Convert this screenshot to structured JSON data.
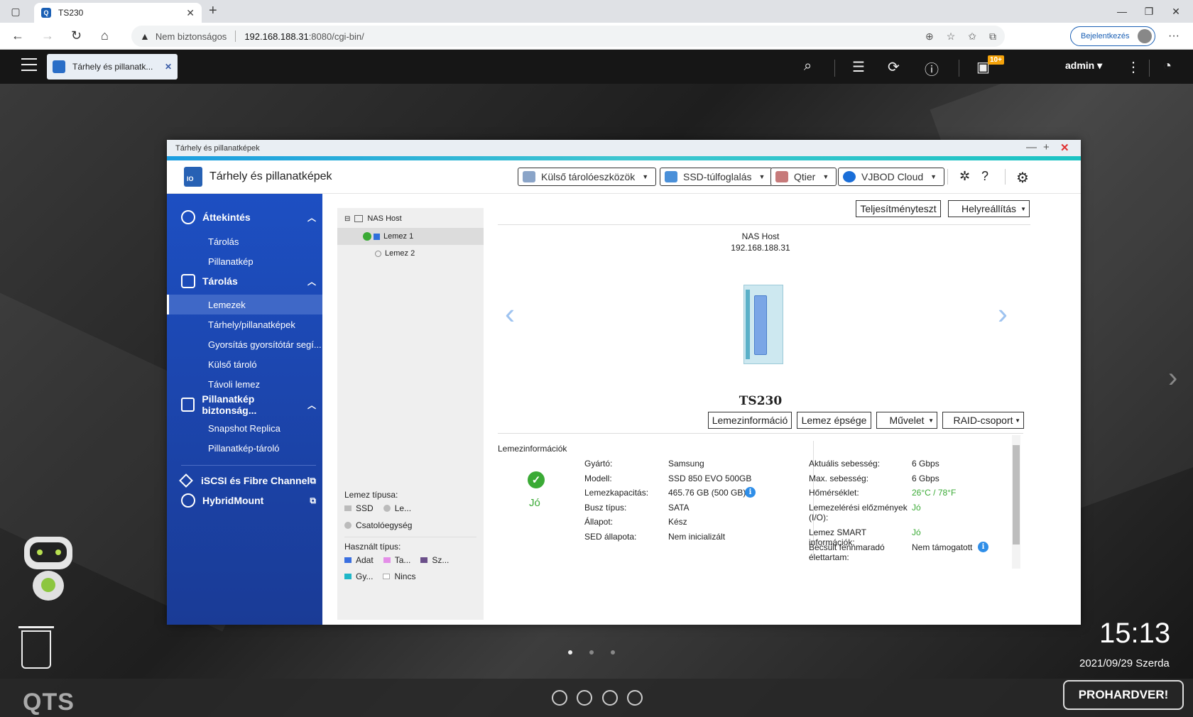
{
  "browser": {
    "tab_title": "TS230",
    "security_label": "Nem biztonságos",
    "url_host": "192.168.188.31",
    "url_rest": ":8080/cgi-bin/",
    "login_label": "Bejelentkezés"
  },
  "qts": {
    "app_tab": "Tárhely és pillanatk...",
    "notification_badge": "10+",
    "user": "admin",
    "clock": "15:13",
    "date": "2021/09/29 Szerda",
    "logo": "QTS",
    "watermark": "PROHARDVER!"
  },
  "window": {
    "title": "Tárhely és pillanatképek",
    "app_name": "Tárhely és pillanatképek",
    "toolbar": {
      "external": "Külső tárolóeszközök",
      "ssd": "SSD-túlfoglalás",
      "qtier": "Qtier",
      "vjbod": "VJBOD Cloud"
    }
  },
  "sidebar": {
    "overview": "Áttekintés",
    "overview_items": [
      "Tárolás",
      "Pillanatkép"
    ],
    "storage": "Tárolás",
    "storage_items": [
      "Lemezek",
      "Tárhely/pillanatképek",
      "Gyorsítás gyorsítótár segí...",
      "Külső tároló",
      "Távoli lemez"
    ],
    "snapshot": "Pillanatkép biztonság...",
    "snapshot_items": [
      "Snapshot Replica",
      "Pillanatkép-tároló"
    ],
    "iscsi": "iSCSI és Fibre Channel",
    "hybridmount": "HybridMount"
  },
  "tree": {
    "root": "NAS Host",
    "disk1": "Lemez 1",
    "disk2": "Lemez 2",
    "disk_type_label": "Lemez típusa:",
    "disk_types": [
      "SSD",
      "Le...",
      "Csatolóegység"
    ],
    "used_type_label": "Használt típus:",
    "used_types": [
      "Adat",
      "Ta...",
      "Sz...",
      "Gy...",
      "Nincs"
    ]
  },
  "main": {
    "perf_test": "Teljesítményteszt",
    "restore": "Helyreállítás",
    "host_name": "NAS Host",
    "host_ip": "192.168.188.31",
    "model": "TS230",
    "btn_diskinfo": "Lemezinformáció",
    "btn_health": "Lemez épsége",
    "btn_action": "Művelet",
    "btn_raid": "RAID-csoport",
    "info_title": "Lemezinformációk",
    "status": "Jó",
    "left_info": [
      {
        "k": "Gyártó:",
        "v": "Samsung"
      },
      {
        "k": "Modell:",
        "v": "SSD 850 EVO 500GB"
      },
      {
        "k": "Lemezkapacitás:",
        "v": "465.76 GB (500 GB)"
      },
      {
        "k": "Busz típus:",
        "v": "SATA"
      },
      {
        "k": "Állapot:",
        "v": "Kész"
      },
      {
        "k": "SED állapota:",
        "v": "Nem inicializált"
      }
    ],
    "right_info": [
      {
        "k": "Aktuális sebesség:",
        "v": "6 Gbps"
      },
      {
        "k": "Max. sebesség:",
        "v": "6 Gbps"
      },
      {
        "k": "Hőmérséklet:",
        "v": "26°C / 78°F"
      },
      {
        "k": "Lemezelérési előzmények (I/O):",
        "v": "Jó"
      },
      {
        "k": "Lemez SMART információk:",
        "v": "Jó"
      },
      {
        "k": "Becsült fennmaradó élettartam:",
        "v": "Nem támogatott"
      }
    ]
  },
  "colors": {
    "sidebar_top": "#1d4fc2",
    "good": "#3aaa35",
    "info_blue": "#2f8ee8"
  }
}
